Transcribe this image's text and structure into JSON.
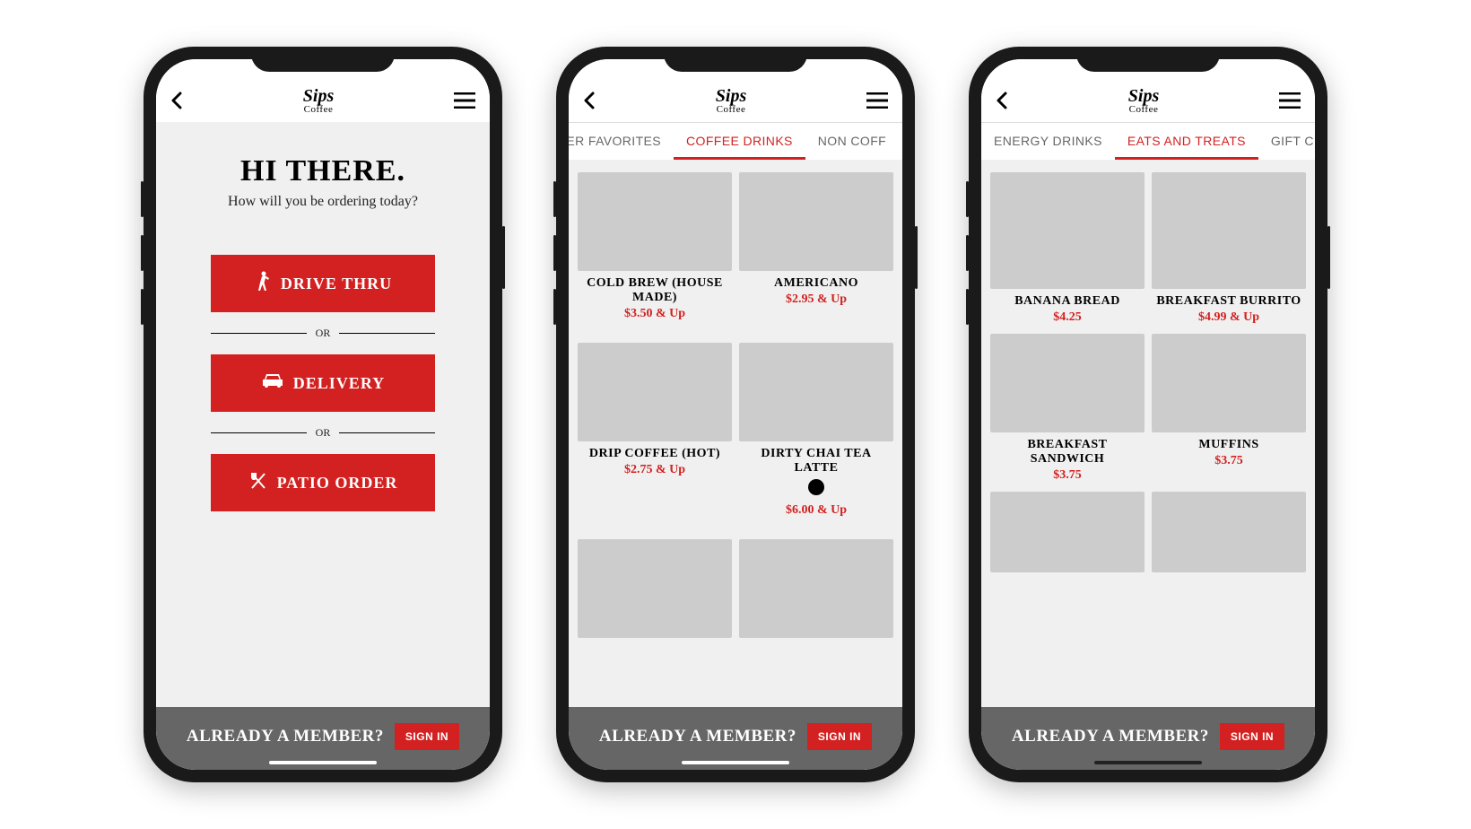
{
  "brand": {
    "line1": "Sips",
    "line2": "Coffee"
  },
  "footer": {
    "question": "ALREADY A MEMBER?",
    "button": "SIGN IN"
  },
  "or_label": "OR",
  "screens": [
    {
      "title": "HI THERE.",
      "subtitle": "How will you be ordering today?",
      "options": [
        {
          "label": "DRIVE THRU",
          "icon": "walk"
        },
        {
          "label": "DELIVERY",
          "icon": "car"
        },
        {
          "label": "PATIO ORDER",
          "icon": "dine"
        }
      ]
    },
    {
      "tabs": [
        {
          "label": "OMER FAVORITES",
          "active": false
        },
        {
          "label": "COFFEE DRINKS",
          "active": true
        },
        {
          "label": "NON COFF",
          "active": false
        }
      ],
      "products": [
        {
          "name": "COLD BREW (HOUSE MADE)",
          "price": "$3.50 & Up"
        },
        {
          "name": "AMERICANO",
          "price": "$2.95 & Up"
        },
        {
          "name": "DRIP COFFEE (HOT)",
          "price": "$2.75 & Up"
        },
        {
          "name": "DIRTY CHAI TEA LATTE",
          "price": "$6.00 & Up",
          "gf": true
        },
        {
          "name": "",
          "price": ""
        },
        {
          "name": "",
          "price": ""
        }
      ]
    },
    {
      "tabs": [
        {
          "label": "ENERGY DRINKS",
          "active": false
        },
        {
          "label": "EATS AND TREATS",
          "active": true
        },
        {
          "label": "GIFT C",
          "active": false
        }
      ],
      "products": [
        {
          "name": "BANANA BREAD",
          "price": "$4.25"
        },
        {
          "name": "BREAKFAST BURRITO",
          "price": "$4.99 & Up"
        },
        {
          "name": "BREAKFAST SANDWICH",
          "price": "$3.75"
        },
        {
          "name": "MUFFINS",
          "price": "$3.75"
        },
        {
          "name": "",
          "price": ""
        },
        {
          "name": "",
          "price": ""
        }
      ]
    }
  ]
}
